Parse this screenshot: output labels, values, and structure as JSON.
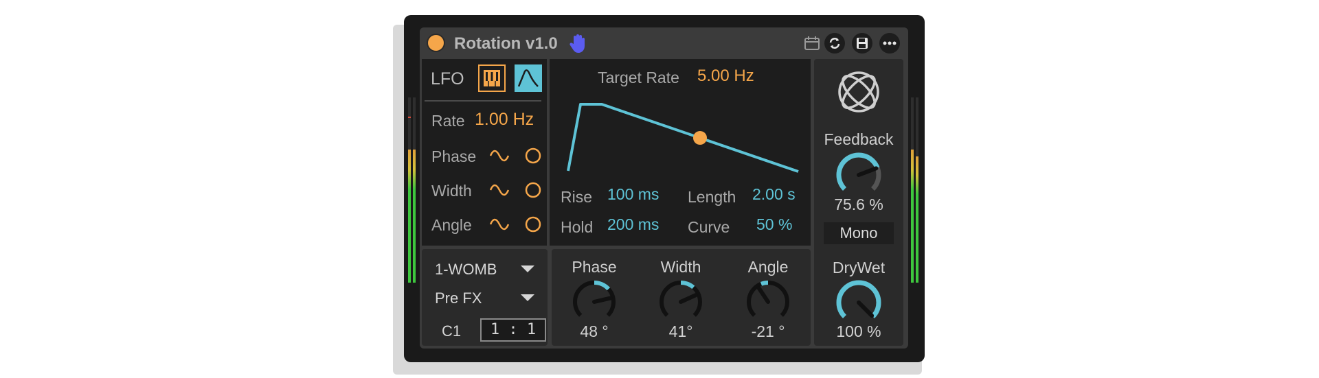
{
  "device": {
    "title": "Rotation v1.0",
    "accent_orange": "#f5a64a",
    "accent_cyan": "#5ec3d6",
    "hand_icon": "hand-icon",
    "toolbar_icons": [
      "calendar-icon",
      "refresh-icon",
      "save-icon",
      "more-icon"
    ]
  },
  "lfo": {
    "label": "LFO",
    "keyboard_mode_icon": "piano-icon",
    "envelope_mode_icon": "envelope-icon",
    "rate_label": "Rate",
    "rate_value": "1.00 Hz",
    "rows": [
      {
        "label": "Phase",
        "wave_icon": "sine-icon",
        "toggle_icon": "circle-icon"
      },
      {
        "label": "Width",
        "wave_icon": "sine-icon",
        "toggle_icon": "circle-icon"
      },
      {
        "label": "Angle",
        "wave_icon": "sine-icon",
        "toggle_icon": "circle-icon"
      }
    ]
  },
  "envelope": {
    "target_rate_label": "Target Rate",
    "target_rate_value": "5.00 Hz",
    "rise_label": "Rise",
    "rise_value": "100 ms",
    "hold_label": "Hold",
    "hold_value": "200 ms",
    "length_label": "Length",
    "length_value": "2.00 s",
    "curve_label": "Curve",
    "curve_value": "50 %"
  },
  "right": {
    "logo_icon": "orbit-icon",
    "feedback_label": "Feedback",
    "feedback_value": "75.6 %",
    "feedback_level": 0.756,
    "mono_label": "Mono",
    "drywet_label": "DryWet",
    "drywet_value": "100 %",
    "drywet_level": 1.0
  },
  "routing": {
    "source": "1-WOMB",
    "position": "Pre FX",
    "note": "C1",
    "ratio": "1 : 1"
  },
  "knobs": [
    {
      "label": "Phase",
      "value": "48 °",
      "degrees": 48
    },
    {
      "label": "Width",
      "value": "41°",
      "degrees": 41
    },
    {
      "label": "Angle",
      "value": "-21 °",
      "degrees": -21
    }
  ],
  "meters": {
    "left_level": 0.78,
    "right_level": 0.78
  }
}
